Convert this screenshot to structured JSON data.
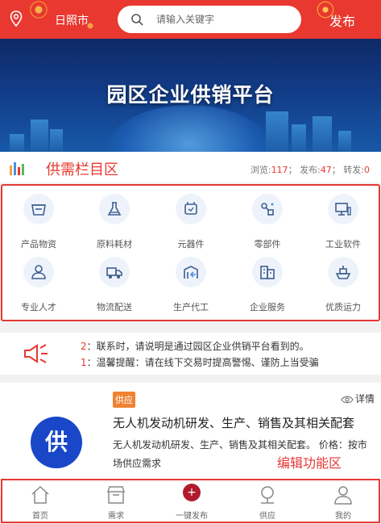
{
  "header": {
    "city": "日照市",
    "search_placeholder": "请输入关键字",
    "publish_label": "发布"
  },
  "banner": {
    "title": "园区企业供销平台"
  },
  "stats_section": {
    "title": "供需栏目区",
    "views_label": "浏览:",
    "views": "117",
    "publish_label": "发布:",
    "publish": "47",
    "forward_label": "转发:",
    "forward": "0"
  },
  "categories": [
    {
      "label": "产品物资",
      "icon": "box-icon"
    },
    {
      "label": "原料耗材",
      "icon": "flask-icon"
    },
    {
      "label": "元器件",
      "icon": "chip-icon"
    },
    {
      "label": "零部件",
      "icon": "parts-icon"
    },
    {
      "label": "工业软件",
      "icon": "computer-icon"
    },
    {
      "label": "专业人才",
      "icon": "person-icon"
    },
    {
      "label": "物流配送",
      "icon": "truck-icon"
    },
    {
      "label": "生产代工",
      "icon": "factory-icon"
    },
    {
      "label": "企业服务",
      "icon": "building-icon"
    },
    {
      "label": "优质运力",
      "icon": "ship-icon"
    }
  ],
  "notice": {
    "lines": [
      {
        "index": "2",
        "text": "：联系时，请说明是通过园区企业供销平台看到的。"
      },
      {
        "index": "1",
        "text": "：温馨提醒：请在线下交易时提高警惕、谨防上当受骗"
      }
    ]
  },
  "card": {
    "avatar_char": "供",
    "badge": "供应",
    "detail_label": "详情",
    "title": "无人机发动机研发、生产、销售及其相关配套",
    "description": "无人机发动机研发、生产、销售及其相关配套。 价格：按市场供应需求",
    "annotation": "编辑功能区"
  },
  "bottom_nav": [
    {
      "label": "首页",
      "icon": "home-icon"
    },
    {
      "label": "需求",
      "icon": "store-icon"
    },
    {
      "label": "一键发布",
      "icon": "plus-icon"
    },
    {
      "label": "供应",
      "icon": "supply-icon"
    },
    {
      "label": "我的",
      "icon": "user-icon"
    }
  ],
  "colors": {
    "brand_red": "#e8382f",
    "annotation_red": "#e53935",
    "badge_orange": "#f08232",
    "avatar_blue": "#1947c8",
    "icon_blue": "#3f5f8f"
  }
}
